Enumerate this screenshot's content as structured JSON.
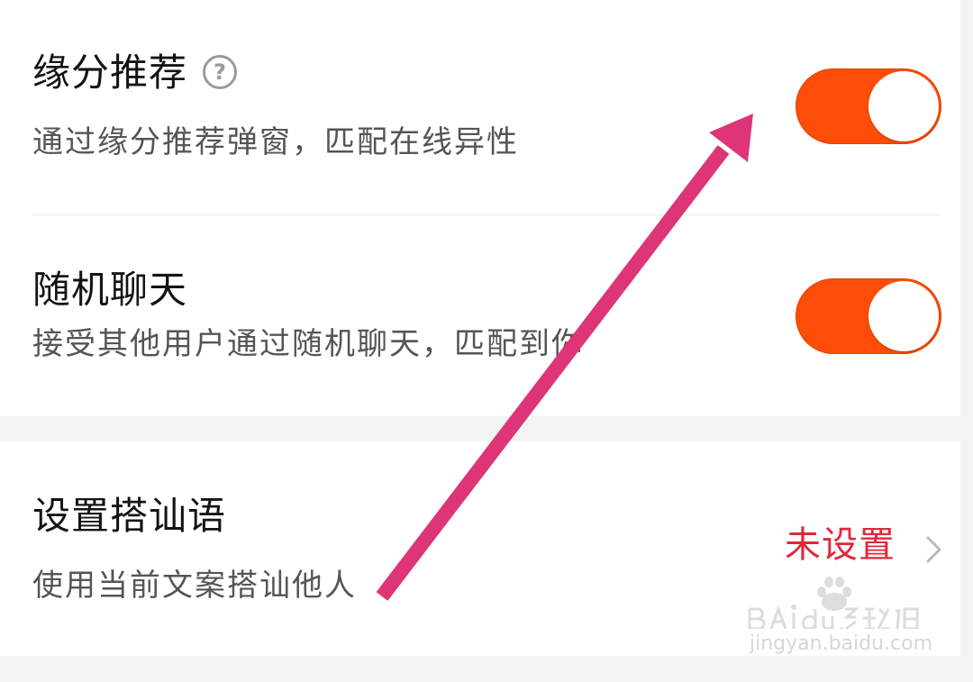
{
  "settings": {
    "rows": [
      {
        "title": "缘分推荐",
        "description": "通过缘分推荐弹窗，匹配在线异性",
        "help_icon": "question-circle-icon",
        "toggle_on": true
      },
      {
        "title": "随机聊天",
        "description": "接受其他用户通过随机聊天，匹配到你",
        "toggle_on": true
      },
      {
        "title": "设置搭讪语",
        "description": "使用当前文案搭讪他人",
        "value": "未设置",
        "icon": "chevron-right-icon"
      }
    ]
  },
  "help_icon_glyph": "?",
  "watermark": {
    "logo_text": "Baidu经验",
    "url": "jingyan.baidu.com"
  },
  "colors": {
    "toggle_on": "#ff4d07",
    "value_text": "#e0283a",
    "annotation_arrow": "#dd3577"
  }
}
